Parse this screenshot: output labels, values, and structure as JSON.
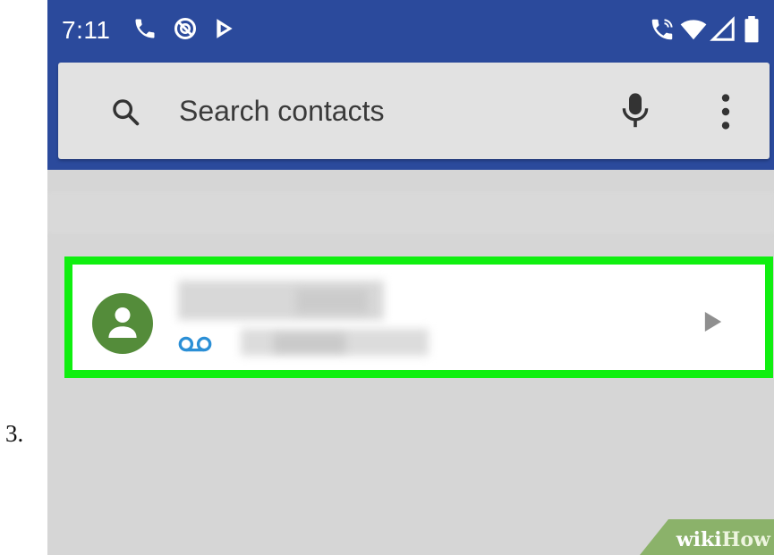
{
  "step_number": "3.",
  "status_bar": {
    "time": "7:11",
    "left_icons": [
      "phone-call-icon",
      "block-icon",
      "play-store-icon"
    ],
    "right_icons": [
      "wifi-calling-icon",
      "wifi-icon",
      "signal-icon",
      "battery-icon"
    ],
    "color": "#2b4a9c"
  },
  "search": {
    "placeholder": "Search contacts",
    "icons": [
      "search-icon",
      "microphone-icon",
      "more-options-icon"
    ]
  },
  "contact": {
    "avatar_icon": "person-icon",
    "name": "",
    "secondary_icon": "voicemail-icon",
    "action_icon": "play-icon",
    "highlight_color": "#10ef10"
  },
  "watermark": {
    "prefix": "wiki",
    "suffix": "How"
  }
}
